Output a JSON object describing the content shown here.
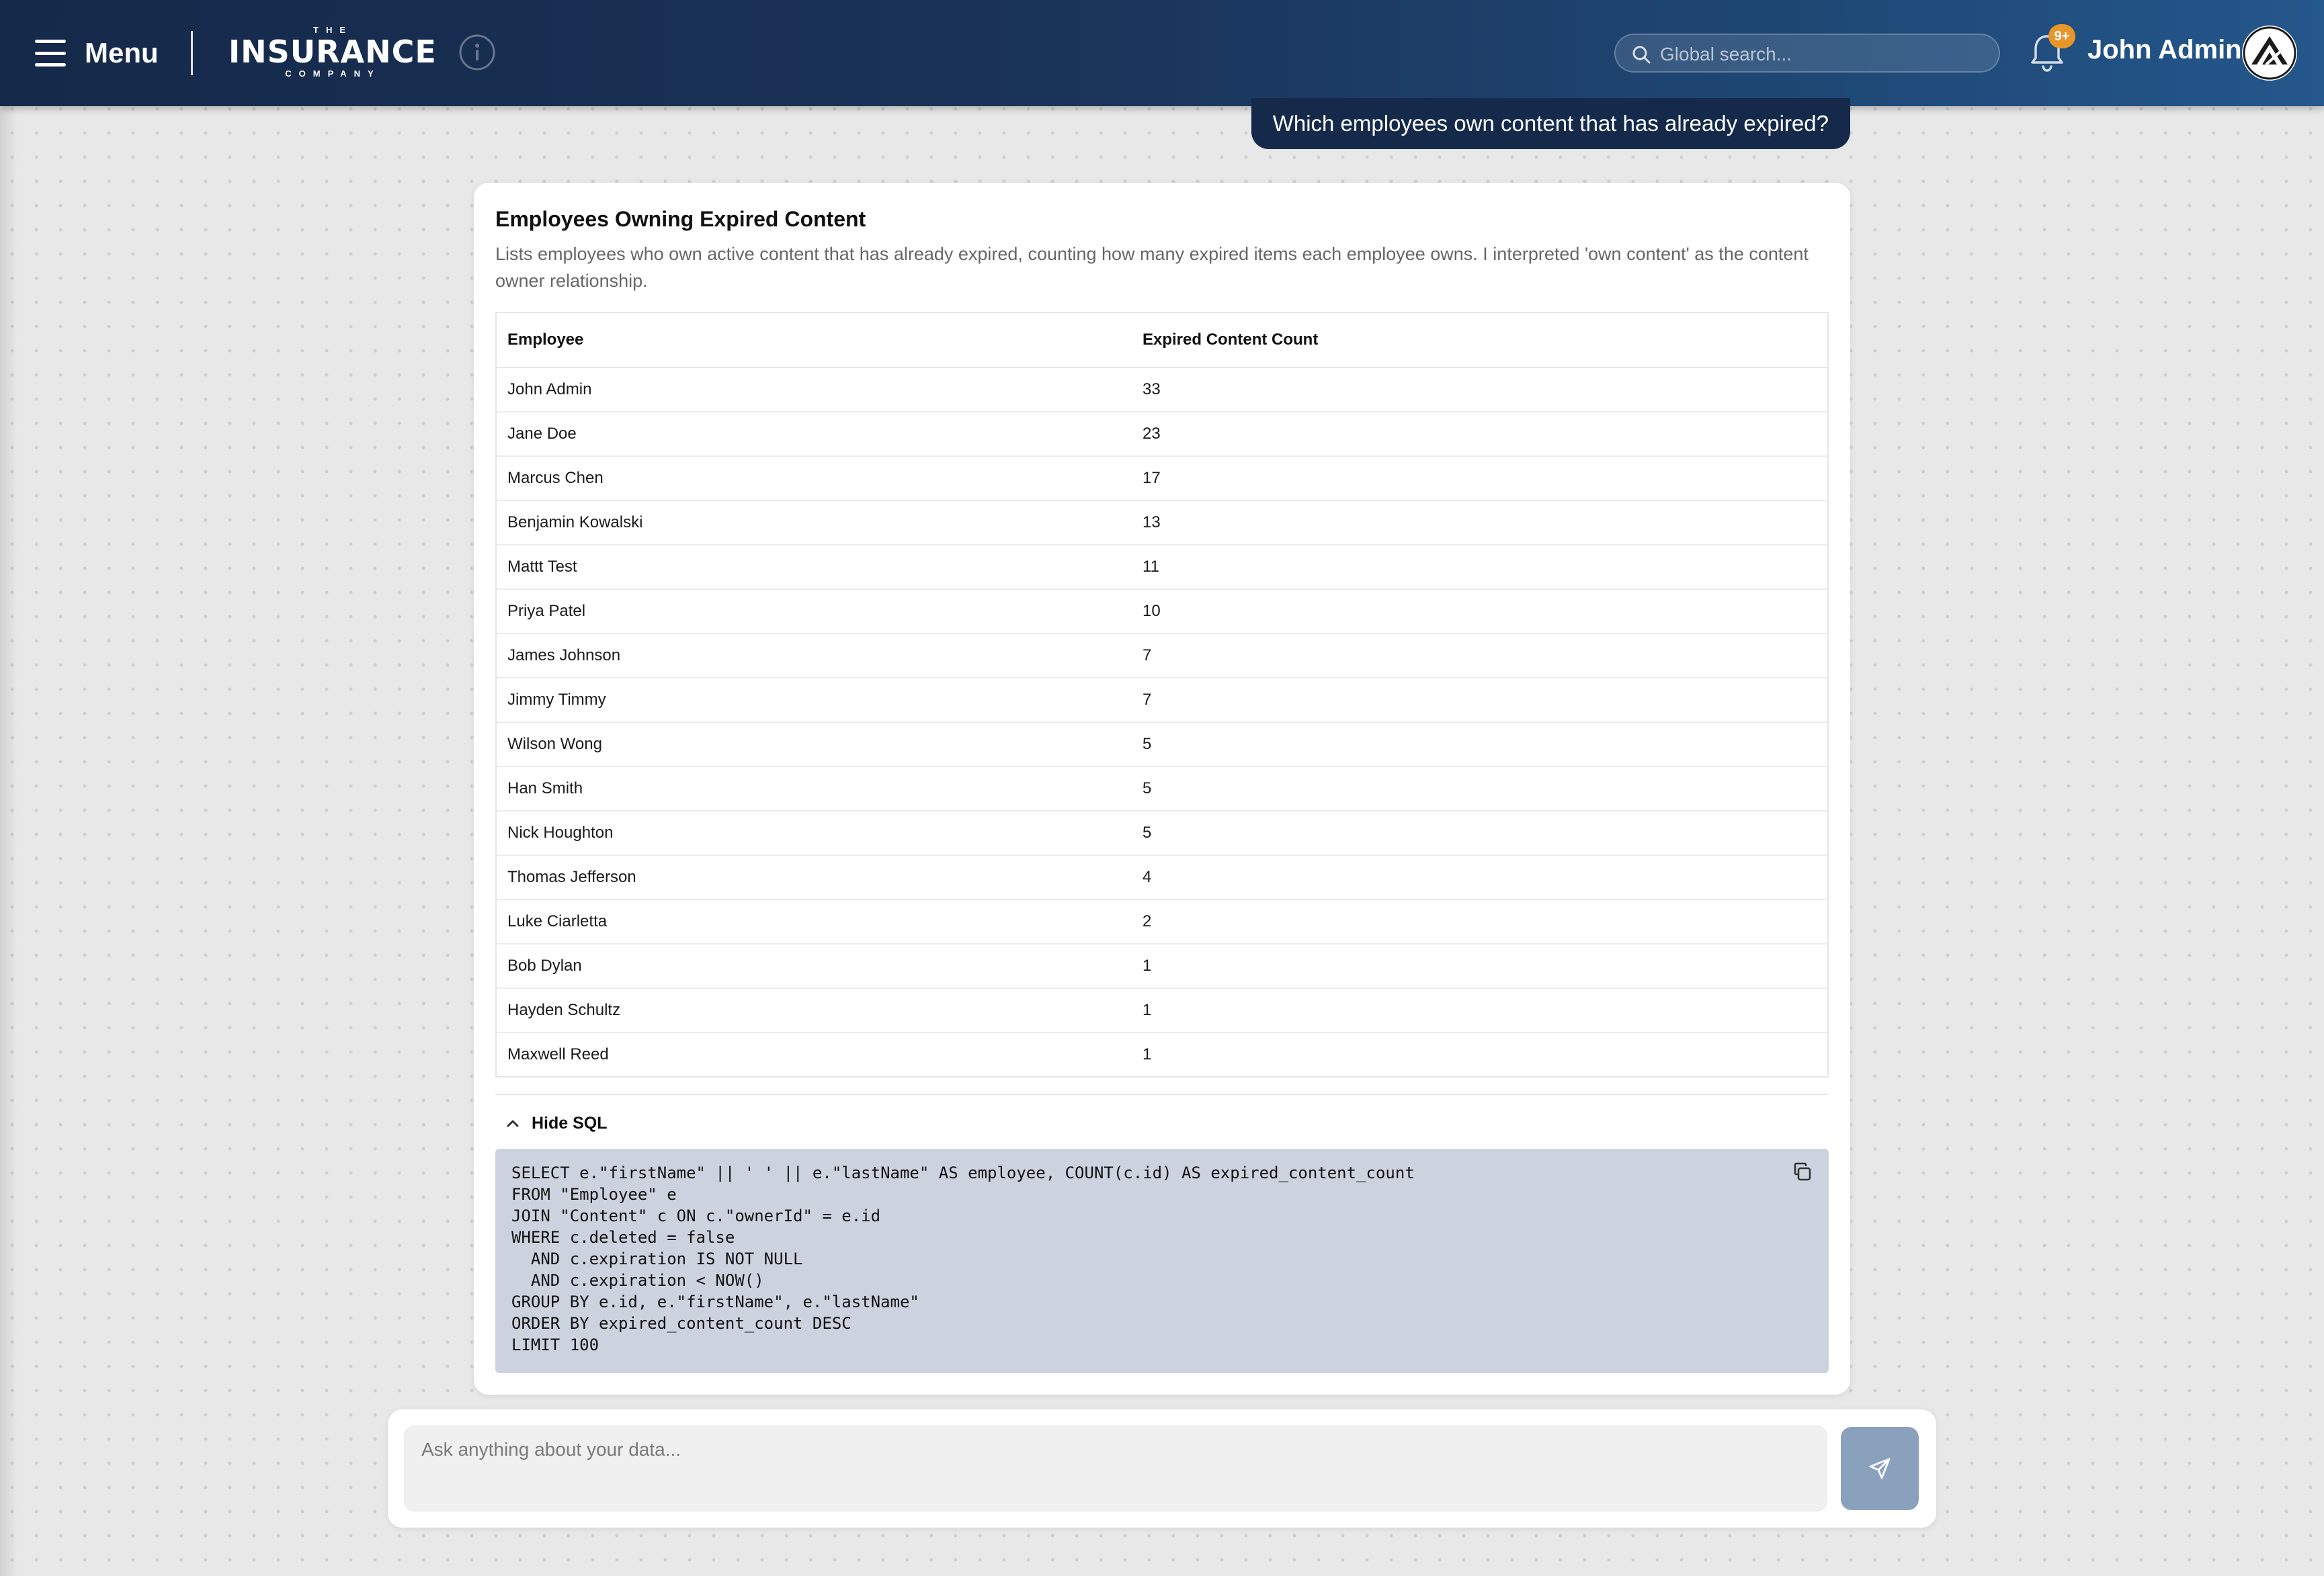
{
  "header": {
    "menu_label": "Menu",
    "logo": {
      "the": "THE",
      "main": "INSURANCE",
      "company": "COMPANY"
    },
    "search_placeholder": "Global search...",
    "notification_badge": "9+",
    "user_name": "John Admin"
  },
  "chat": {
    "user_question": "Which employees own content that has already expired?",
    "result": {
      "title": "Employees Owning Expired Content",
      "description": "Lists employees who own active content that has already expired, counting how many expired items each employee owns. I interpreted 'own content' as the content owner relationship.",
      "columns": [
        "Employee",
        "Expired Content Count"
      ],
      "rows": [
        [
          "John Admin",
          "33"
        ],
        [
          "Jane Doe",
          "23"
        ],
        [
          "Marcus Chen",
          "17"
        ],
        [
          "Benjamin Kowalski",
          "13"
        ],
        [
          "Mattt Test",
          "11"
        ],
        [
          "Priya Patel",
          "10"
        ],
        [
          "James Johnson",
          "7"
        ],
        [
          "Jimmy Timmy",
          "7"
        ],
        [
          "Wilson Wong",
          "5"
        ],
        [
          "Han Smith",
          "5"
        ],
        [
          "Nick Houghton",
          "5"
        ],
        [
          "Thomas Jefferson",
          "4"
        ],
        [
          "Luke Ciarletta",
          "2"
        ],
        [
          "Bob Dylan",
          "1"
        ],
        [
          "Hayden Schultz",
          "1"
        ],
        [
          "Maxwell Reed",
          "1"
        ]
      ],
      "sql_toggle_label": "Hide SQL",
      "sql": "SELECT e.\"firstName\" || ' ' || e.\"lastName\" AS employee, COUNT(c.id) AS expired_content_count\nFROM \"Employee\" e\nJOIN \"Content\" c ON c.\"ownerId\" = e.id\nWHERE c.deleted = false\n  AND c.expiration IS NOT NULL\n  AND c.expiration < NOW()\nGROUP BY e.id, e.\"firstName\", e.\"lastName\"\nORDER BY expired_content_count DESC\nLIMIT 100"
    }
  },
  "composer": {
    "placeholder": "Ask anything about your data..."
  },
  "colors": {
    "header_start": "#15294a",
    "header_end": "#24578c",
    "user_bubble": "#152a4a",
    "badge": "#e8952a",
    "sql_background": "#cdd3de",
    "send_button": "#8aa1bd"
  }
}
